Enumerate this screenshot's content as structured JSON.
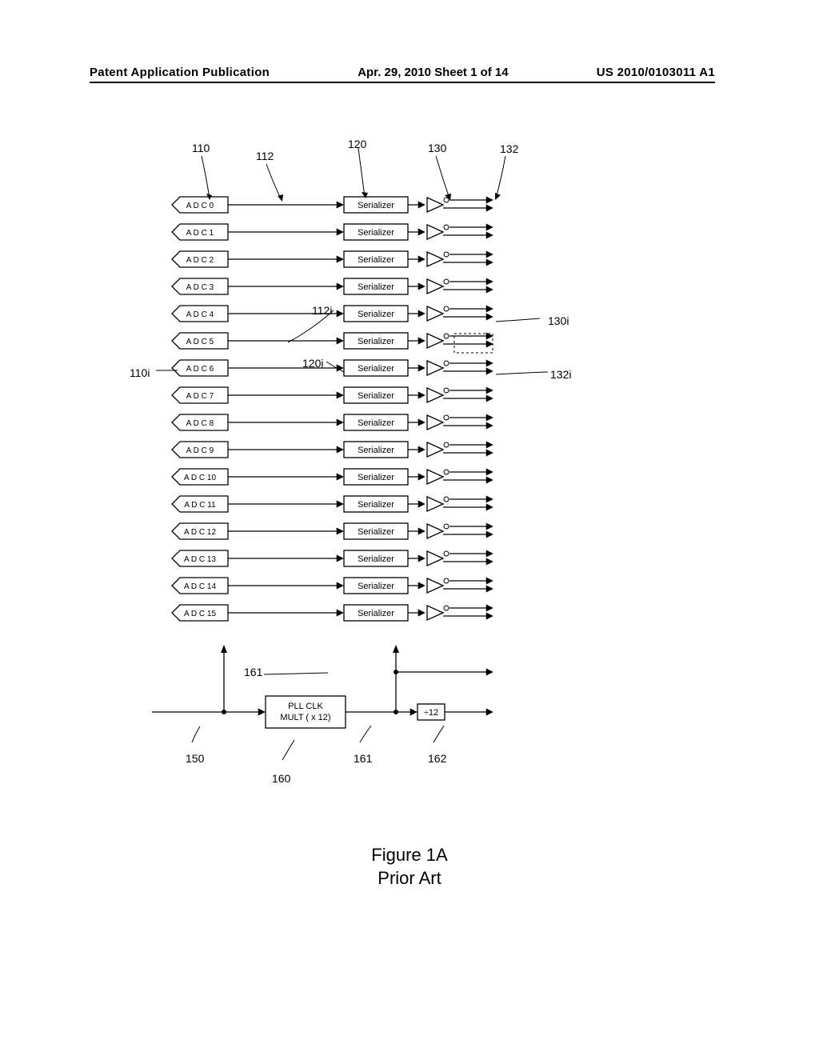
{
  "header": {
    "left": "Patent Application Publication",
    "center": "Apr. 29, 2010  Sheet 1 of 14",
    "right": "US 2010/0103011 A1"
  },
  "caption": {
    "line1": "Figure 1A",
    "line2": "Prior Art"
  },
  "refs": {
    "r110": "110",
    "r112": "112",
    "r120": "120",
    "r130": "130",
    "r132": "132",
    "r112i": "112i",
    "r120i": "120i",
    "r110i": "110i",
    "r130i": "130i",
    "r132i": "132i",
    "r161top": "161",
    "r150": "150",
    "r161bot": "161",
    "r160": "160",
    "r162": "162"
  },
  "blocks": {
    "adc_prefix": "A D C",
    "serializer": "Serializer",
    "pll_line1": "PLL CLK",
    "pll_line2": "MULT ( x 12)",
    "div": "÷12"
  },
  "channels": [
    {
      "idx": "0"
    },
    {
      "idx": "1"
    },
    {
      "idx": "2"
    },
    {
      "idx": "3"
    },
    {
      "idx": "4"
    },
    {
      "idx": "5"
    },
    {
      "idx": "6"
    },
    {
      "idx": "7"
    },
    {
      "idx": "8"
    },
    {
      "idx": "9"
    },
    {
      "idx": "10"
    },
    {
      "idx": "11"
    },
    {
      "idx": "12"
    },
    {
      "idx": "13"
    },
    {
      "idx": "14"
    },
    {
      "idx": "15"
    }
  ]
}
